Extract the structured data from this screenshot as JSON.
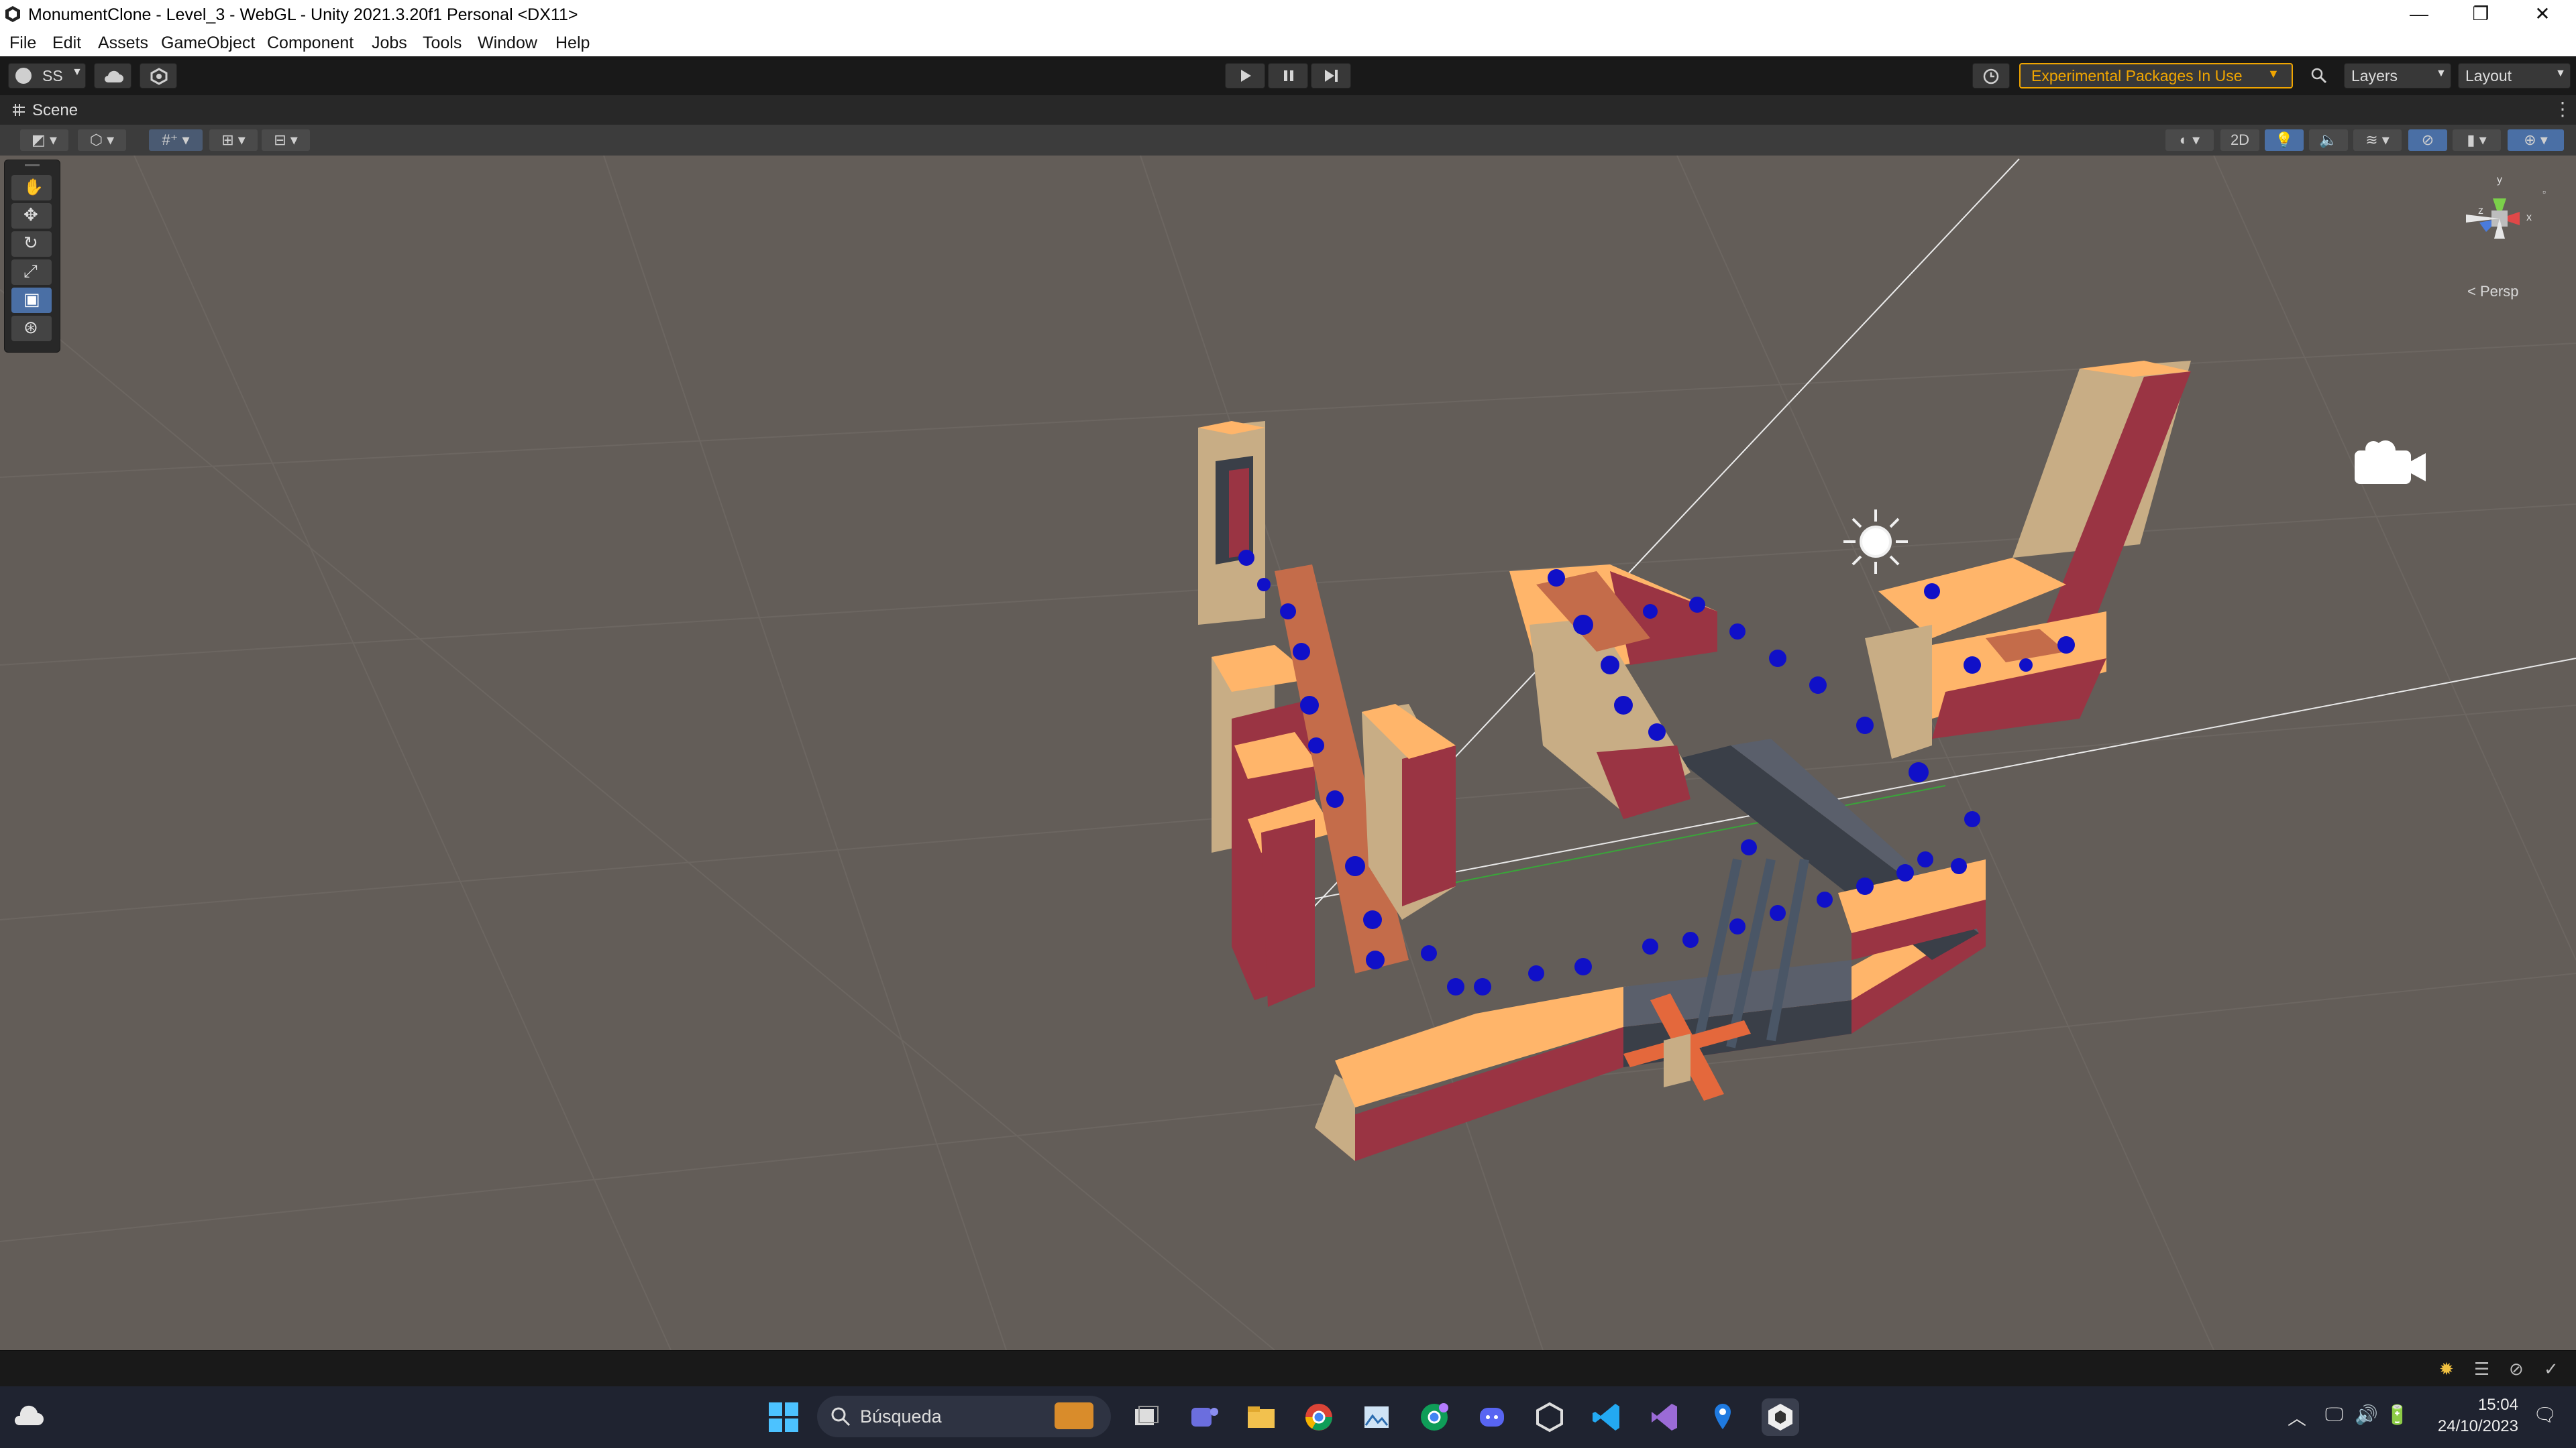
{
  "window": {
    "title": "MonumentClone - Level_3 - WebGL - Unity 2021.3.20f1 Personal <DX11>",
    "minimize": "—",
    "maximize": "❐",
    "close": "✕"
  },
  "menu": [
    "File",
    "Edit",
    "Assets",
    "GameObject",
    "Component",
    "Jobs",
    "Tools",
    "Window",
    "Help"
  ],
  "toolbar": {
    "account_label": "SS",
    "experimental_label": "Experimental Packages In Use",
    "layers_label": "Layers",
    "layout_label": "Layout",
    "accent_color": "#f0a500"
  },
  "scene": {
    "tab_label": "Scene",
    "toggle_2d": "2D",
    "projection_label": "< Persp",
    "gizmo_axes": {
      "x": "x",
      "y": "y",
      "z": "z"
    }
  },
  "taskbar": {
    "search_placeholder": "Búsqueda",
    "time": "15:04",
    "date": "24/10/2023"
  }
}
